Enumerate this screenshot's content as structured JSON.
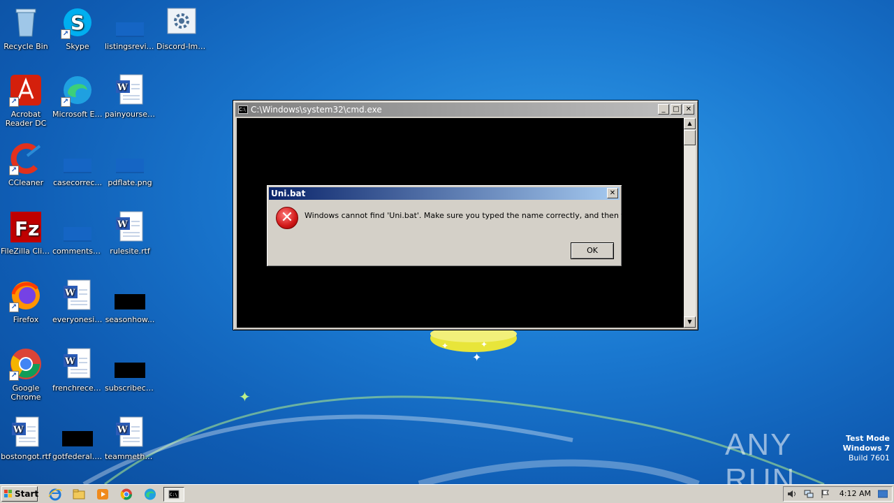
{
  "desktop_icons": [
    {
      "label": "Recycle Bin",
      "icon": "recycle-bin-icon"
    },
    {
      "label": "Skype",
      "icon": "skype-icon"
    },
    {
      "label": "listingsrevie...",
      "icon": "image-file-icon"
    },
    {
      "label": "Discord-Ima...",
      "icon": "settings-file-icon"
    },
    {
      "label": "Acrobat Reader DC",
      "icon": "acrobat-icon"
    },
    {
      "label": "Microsoft Edge",
      "icon": "edge-icon"
    },
    {
      "label": "painyourself...",
      "icon": "word-doc-icon"
    },
    {
      "label": "CCleaner",
      "icon": "ccleaner-icon"
    },
    {
      "label": "casecorrec...",
      "icon": "image-file-icon"
    },
    {
      "label": "pdflate.png",
      "icon": "image-file-icon"
    },
    {
      "label": "FileZilla Client",
      "icon": "filezilla-icon"
    },
    {
      "label": "commentslit...",
      "icon": "image-file-icon"
    },
    {
      "label": "rulesite.rtf",
      "icon": "word-doc-icon"
    },
    {
      "label": "Firefox",
      "icon": "firefox-icon"
    },
    {
      "label": "everyonesix...",
      "icon": "word-doc-icon"
    },
    {
      "label": "seasonhow...",
      "icon": "black-image-icon"
    },
    {
      "label": "Google Chrome",
      "icon": "chrome-icon"
    },
    {
      "label": "frenchrecen...",
      "icon": "word-doc-icon"
    },
    {
      "label": "subscribecu...",
      "icon": "black-image-icon"
    },
    {
      "label": "bostongot.rtf",
      "icon": "word-doc-icon"
    },
    {
      "label": "gotfederal.jpg",
      "icon": "black-image-icon"
    },
    {
      "label": "teammetho...",
      "icon": "word-doc-icon"
    }
  ],
  "cmd_window": {
    "title": "C:\\Windows\\system32\\cmd.exe",
    "icon_text": "C:\\",
    "minimize": "_",
    "maximize": "□",
    "close": "✕"
  },
  "dialog": {
    "title": "Uni.bat",
    "message": "Windows cannot find 'Uni.bat'. Make sure you typed the name correctly, and then try again.",
    "ok_label": "OK",
    "close": "✕"
  },
  "watermark": {
    "logo": "ANY RUN",
    "line1": "Test Mode",
    "line2": "Windows 7",
    "line3": "Build 7601"
  },
  "taskbar": {
    "start_label": "Start",
    "apps": [
      "internet-explorer-icon",
      "file-explorer-icon",
      "media-player-icon",
      "chrome-icon",
      "edge-icon",
      "cmd-icon"
    ],
    "clock": "4:12 AM"
  }
}
